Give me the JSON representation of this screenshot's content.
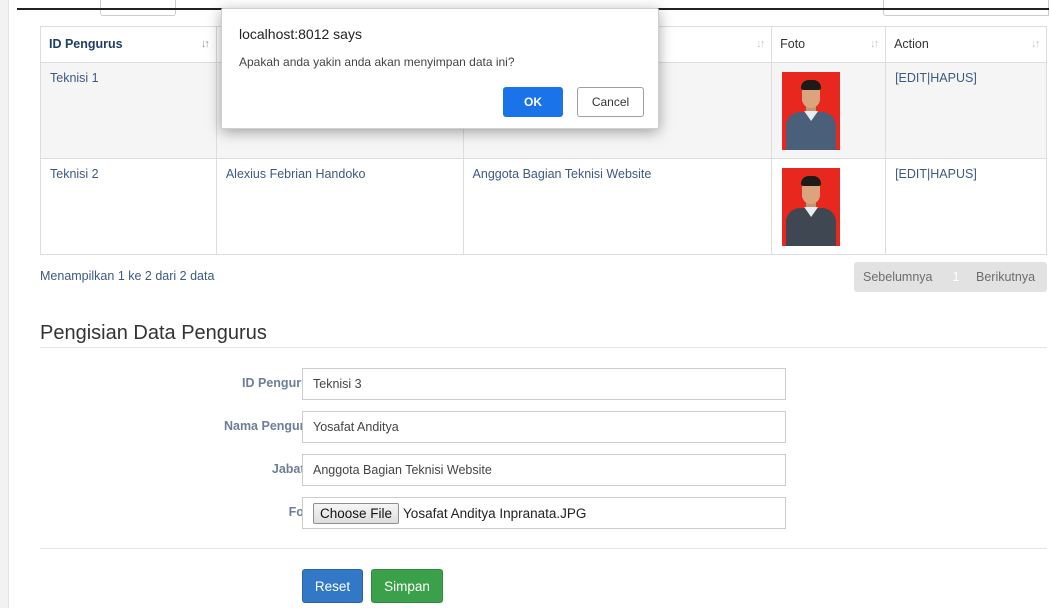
{
  "table": {
    "columns": [
      {
        "label": "ID Pengurus",
        "sort_icon": "sort-asc-icon"
      },
      {
        "label": "",
        "sort_icon": "sort-icon"
      },
      {
        "label": "",
        "sort_icon": "sort-icon"
      },
      {
        "label": "Foto",
        "sort_icon": "sort-icon"
      },
      {
        "label": "Action",
        "sort_icon": "sort-icon"
      }
    ],
    "rows": [
      {
        "id": "Teknisi 1",
        "nama": "",
        "jabatan": "",
        "foto": "photo",
        "action": "[EDIT|HAPUS]"
      },
      {
        "id": "Teknisi 2",
        "nama": "Alexius Febrian Handoko",
        "jabatan": "Anggota Bagian Teknisi Website",
        "foto": "photo",
        "action": "[EDIT|HAPUS]"
      }
    ]
  },
  "info": "Menampilkan 1 ke 2 dari 2 data",
  "pagination": {
    "prev": "Sebelumnya",
    "current": "1",
    "next": "Berikutnya"
  },
  "form": {
    "title": "Pengisian Data Pengurus",
    "fields": [
      {
        "label": "ID Pengurus *",
        "value": "Teknisi 3"
      },
      {
        "label": "Nama Pengurus*",
        "value": "Yosafat Anditya"
      },
      {
        "label": "Jabatan*",
        "value": "Anggota Bagian Teknisi Website"
      },
      {
        "label": "Foto *",
        "button": "Choose File",
        "value": "Yosafat Anditya Inpranata.JPG"
      }
    ],
    "reset_label": "Reset",
    "save_label": "Simpan"
  },
  "dialog": {
    "title": "localhost:8012 says",
    "message": "Apakah anda yakin anda akan menyimpan data ini?",
    "ok_label": "OK",
    "cancel_label": "Cancel"
  },
  "colors": {
    "ok_button": "#1a73e8",
    "reset_button": "#3378c6",
    "save_button": "#3aa04a",
    "link_text": "#3d5a80"
  }
}
